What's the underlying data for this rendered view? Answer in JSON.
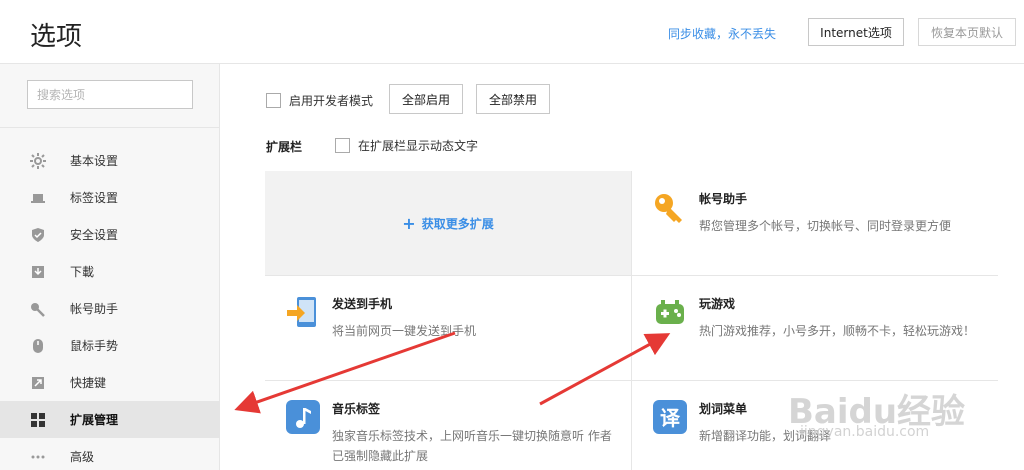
{
  "header": {
    "title": "选项",
    "sync_link": "同步收藏，永不丢失",
    "internet_button": "Internet选项",
    "restore_button": "恢复本页默认"
  },
  "sidebar": {
    "search_placeholder": "搜索选项",
    "items": [
      {
        "label": "基本设置",
        "icon": "gear-icon",
        "active": false
      },
      {
        "label": "标签设置",
        "icon": "laptop-icon",
        "active": false
      },
      {
        "label": "安全设置",
        "icon": "shield-icon",
        "active": false
      },
      {
        "label": "下載",
        "icon": "download-icon",
        "active": false
      },
      {
        "label": "帐号助手",
        "icon": "key-icon",
        "active": false
      },
      {
        "label": "鼠标手势",
        "icon": "mouse-icon",
        "active": false
      },
      {
        "label": "快捷键",
        "icon": "shortcut-icon",
        "active": false
      },
      {
        "label": "扩展管理",
        "icon": "grid-icon",
        "active": true
      },
      {
        "label": "高级",
        "icon": "more-icon",
        "active": false
      }
    ]
  },
  "main": {
    "dev_mode_label": "启用开发者模式",
    "enable_all": "全部启用",
    "disable_all": "全部禁用",
    "ext_bar_label": "扩展栏",
    "ext_bar_option": "在扩展栏显示动态文字",
    "get_more": "获取更多扩展",
    "extensions": [
      {
        "name": "帐号助手",
        "desc": "帮您管理多个帐号，切换帐号、同时登录更方便",
        "icon": "key-icon",
        "color": "#f5a623"
      },
      {
        "name": "发送到手机",
        "desc": "将当前网页一键发送到手机",
        "icon": "send-to-phone-icon",
        "color": "#4a90d9"
      },
      {
        "name": "玩游戏",
        "desc": "热门游戏推荐，小号多开，顺畅不卡，轻松玩游戏！",
        "icon": "gamepad-icon",
        "color": "#6ab04c"
      },
      {
        "name": "音乐标签",
        "desc": "独家音乐标签技术，上网听音乐一键切换随意听 作者已强制隐藏此扩展",
        "icon": "music-icon",
        "color": "#4a90d9"
      },
      {
        "name": "划词菜单",
        "desc": "新增翻译功能，划词翻译",
        "icon": "translate-icon",
        "color": "#4a90d9"
      }
    ]
  },
  "watermark": {
    "text": "Baidu经验",
    "sub": "jingyan.baidu.com"
  }
}
